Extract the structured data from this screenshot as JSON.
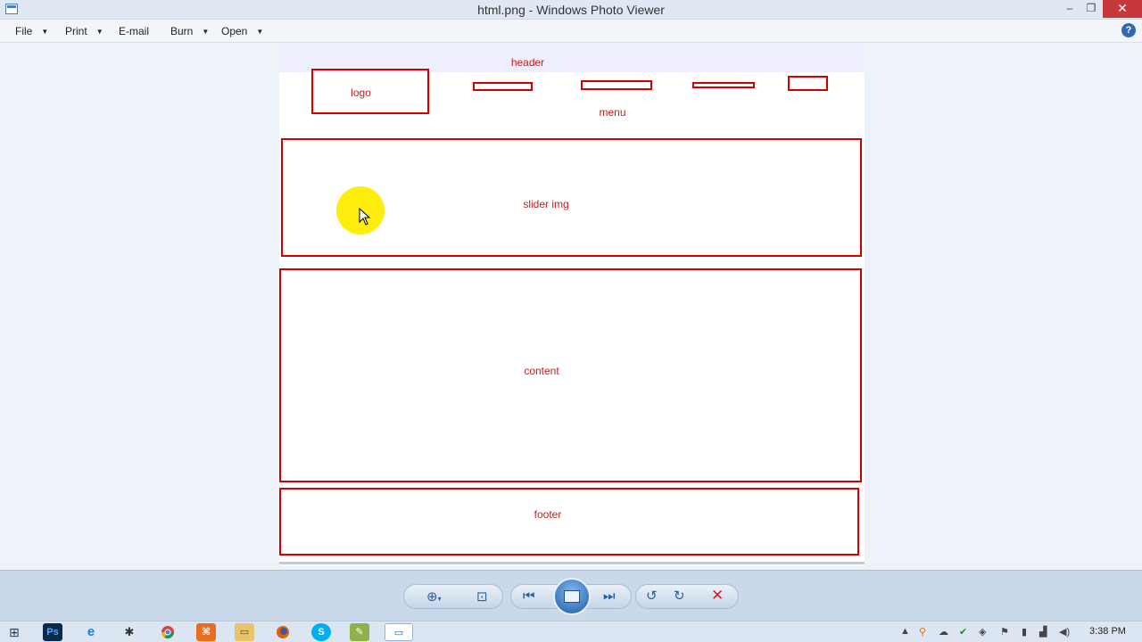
{
  "window": {
    "title": "html.png - Windows Photo Viewer",
    "controls": {
      "minimize": "‒",
      "maximize": "❐",
      "close": "✕"
    }
  },
  "menubar": {
    "items": [
      {
        "label": "File",
        "has_dropdown": true
      },
      {
        "label": "Print",
        "has_dropdown": true
      },
      {
        "label": "E-mail",
        "has_dropdown": false
      },
      {
        "label": "Burn",
        "has_dropdown": true
      },
      {
        "label": "Open",
        "has_dropdown": true
      }
    ],
    "help": "?"
  },
  "image": {
    "labels": {
      "header": "header",
      "logo": "logo",
      "menu": "menu",
      "slider": "slider img",
      "content": "content",
      "footer": "footer"
    },
    "colors": {
      "outline": "#d40000",
      "header_band": "#eeeeff"
    }
  },
  "toolbar": {
    "icons": [
      "zoom-icon",
      "actual-size-icon",
      "previous-icon",
      "slideshow-icon",
      "next-icon",
      "rotate-left-icon",
      "rotate-right-icon",
      "delete-icon"
    ]
  },
  "taskbar": {
    "apps": [
      "start",
      "photoshop",
      "internet-explorer",
      "app-3",
      "chrome",
      "app-5",
      "file-explorer",
      "firefox",
      "skype",
      "notepad",
      "photo-viewer"
    ],
    "clock": "3:38 PM"
  }
}
